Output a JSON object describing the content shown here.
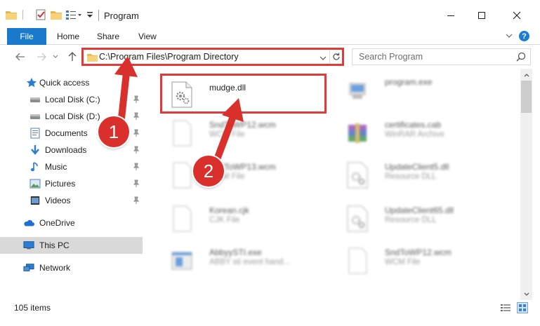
{
  "window": {
    "title": "Program",
    "controls": {
      "minimize": "minimize-icon",
      "maximize": "maximize-icon",
      "close": "close-icon"
    }
  },
  "ribbon": {
    "file": "File",
    "tabs": [
      "Home",
      "Share",
      "View"
    ],
    "help": "?"
  },
  "navigation": {
    "address": "C:\\Program Files\\Program Directory",
    "search_placeholder": "Search Program"
  },
  "sidebar": {
    "items": [
      {
        "label": "Quick access",
        "icon": "star-icon",
        "pinned": false
      },
      {
        "label": "Local Disk (C:)",
        "icon": "drive-icon",
        "pinned": true
      },
      {
        "label": "Local Disk (D:)",
        "icon": "drive-icon",
        "pinned": true
      },
      {
        "label": "Documents",
        "icon": "documents-icon",
        "pinned": true
      },
      {
        "label": "Downloads",
        "icon": "download-icon",
        "pinned": true
      },
      {
        "label": "Music",
        "icon": "music-icon",
        "pinned": true
      },
      {
        "label": "Pictures",
        "icon": "pictures-icon",
        "pinned": true
      },
      {
        "label": "Videos",
        "icon": "videos-icon",
        "pinned": true
      },
      {
        "label": "OneDrive",
        "icon": "cloud-icon",
        "pinned": false
      },
      {
        "label": "This PC",
        "icon": "computer-icon",
        "pinned": false,
        "selected": true
      },
      {
        "label": "Network",
        "icon": "network-icon",
        "pinned": false
      }
    ]
  },
  "files": [
    {
      "name": "mudge.dll",
      "type": "",
      "icon": "dll-gear-icon",
      "highlighted": true
    },
    {
      "name": "program.exe",
      "type": "",
      "icon": "exe-icon"
    },
    {
      "name": "SndToWP12.wcm",
      "type": "WCM File",
      "icon": "blank-file-icon"
    },
    {
      "name": "certificates.cab",
      "type": "WinRAR Archive",
      "icon": "winrar-icon"
    },
    {
      "name": "SndToWP13.wcm",
      "type": "WCM File",
      "icon": "blank-file-icon"
    },
    {
      "name": "UpdateClient5.dll",
      "type": "Resource DLL",
      "icon": "dll-gear-icon"
    },
    {
      "name": "Korean.cjk",
      "type": "CJK File",
      "icon": "blank-file-icon"
    },
    {
      "name": "UpdateClient65.dll",
      "type": "Resource DLL",
      "icon": "dll-gear-icon"
    },
    {
      "name": "AbbyySTI.exe",
      "type": "ABBY sti event hand...",
      "icon": "app-window-icon"
    },
    {
      "name": "SndToWP12.wcm",
      "type": "WCM File",
      "icon": "blank-file-icon"
    }
  ],
  "status": {
    "item_count": "105 items"
  },
  "annotations": {
    "step1": "1",
    "step2": "2"
  },
  "colors": {
    "accent": "#1979ca",
    "highlight": "#e23a3a",
    "badge": "#d9302c"
  }
}
